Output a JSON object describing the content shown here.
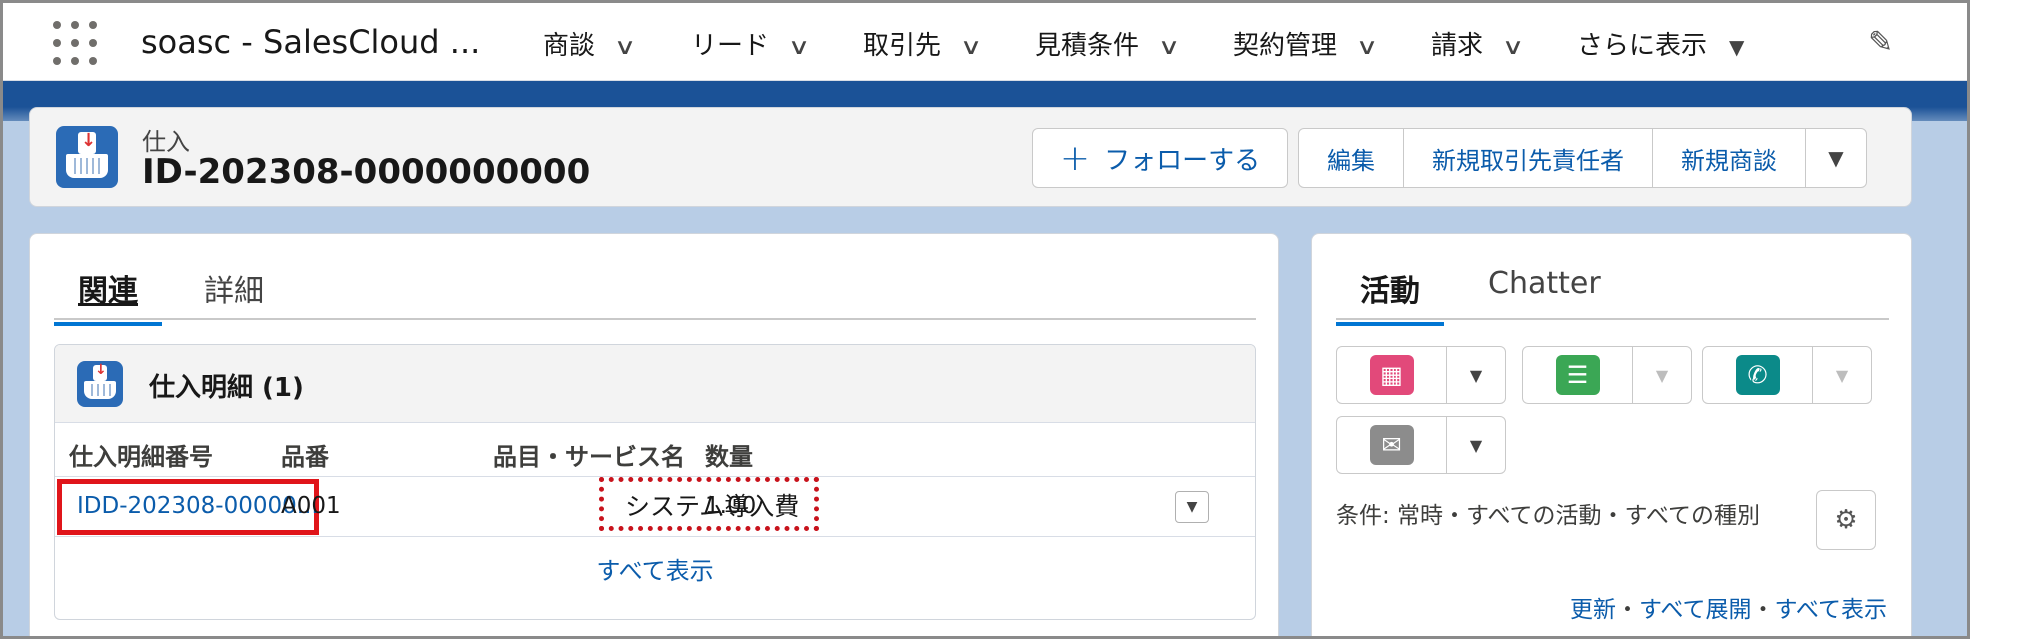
{
  "nav": {
    "app_name": "soasc - SalesCloud ...",
    "items": [
      {
        "label": "商談"
      },
      {
        "label": "リード"
      },
      {
        "label": "取引先"
      },
      {
        "label": "見積条件"
      },
      {
        "label": "契約管理"
      },
      {
        "label": "請求"
      }
    ],
    "more_label": "さらに表示"
  },
  "record": {
    "object_type": "仕入",
    "title": "ID-202308-0000000000",
    "follow_label": "フォローする",
    "actions": [
      "編集",
      "新規取引先責任者",
      "新規商談"
    ]
  },
  "tabs_left": {
    "related": "関連",
    "details": "詳細"
  },
  "related_list": {
    "title": "仕入明細 (1)",
    "columns": [
      "仕入明細番号",
      "品番",
      "品目・サービス名",
      "数量"
    ],
    "rows": [
      {
        "id": "IDD-202308-00000...",
        "part_no": "A001",
        "name": "システム導入費",
        "qty": "1.00"
      }
    ],
    "view_all": "すべて表示"
  },
  "tabs_right": {
    "activity": "活動",
    "chatter": "Chatter"
  },
  "activity": {
    "filter_text": "条件: 常時・すべての活動・すべての種別",
    "links": {
      "refresh": "更新",
      "expand_all": "すべて展開",
      "view_all": "すべて表示",
      "sep": "・"
    }
  },
  "colors": {
    "brand_blue": "#0176d3",
    "link": "#0b5cab",
    "event": "#e2497a",
    "task": "#3ba755",
    "call": "#0b8a89",
    "email": "#8c8c8c",
    "highlight": "#e0151a"
  },
  "icons": [
    "waffle-icon",
    "chevron-down-icon",
    "pencil-icon",
    "purchase-object-icon",
    "plus-icon",
    "calendar-icon",
    "task-list-icon",
    "phone-icon",
    "envelope-icon",
    "gear-icon"
  ]
}
